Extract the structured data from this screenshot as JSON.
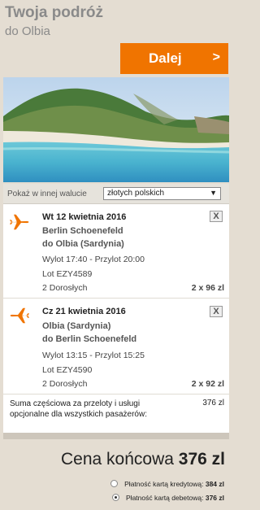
{
  "header": {
    "title": "Twoja podróż",
    "subtitle": "do Olbia"
  },
  "next_button": {
    "label": "Dalej",
    "arrow": ">"
  },
  "currency": {
    "label": "Pokaż w innej walucie",
    "selected": "złotych polskich"
  },
  "flights": [
    {
      "date": "Wt 12 kwietnia 2016",
      "from": "Berlin Schoenefeld",
      "to": "do Olbia (Sardynia)",
      "times": "Wylot 17:40 - Przylot 20:00",
      "flight_no": "Lot EZY4589",
      "passengers": "2 Dorosłych",
      "price": "2 x 96 zl",
      "remove": "X"
    },
    {
      "date": "Cz 21 kwietnia 2016",
      "from": "Olbia (Sardynia)",
      "to": "do Berlin Schoenefeld",
      "times": "Wylot 13:15 - Przylot 15:25",
      "flight_no": "Lot EZY4590",
      "passengers": "2 Dorosłych",
      "price": "2 x 92 zl",
      "remove": "X"
    }
  ],
  "summary": {
    "text": "Suma częściowa za przeloty i usługi opcjonalne dla wszystkich pasażerów:",
    "amount": "376 zl"
  },
  "final_price": {
    "label": "Cena końcowa",
    "amount": "376 zl"
  },
  "payment_options": [
    {
      "label": "Płatność kartą kredytową:",
      "amount": "384 zl",
      "selected": false
    },
    {
      "label": "Płatność kartą debetową:",
      "amount": "376 zl",
      "selected": true
    }
  ],
  "colors": {
    "accent": "#f07400",
    "background": "#e4ddd2"
  },
  "icons": {
    "flight": "plane-icon",
    "remove": "close-icon",
    "dropdown": "chevron-down-icon"
  }
}
